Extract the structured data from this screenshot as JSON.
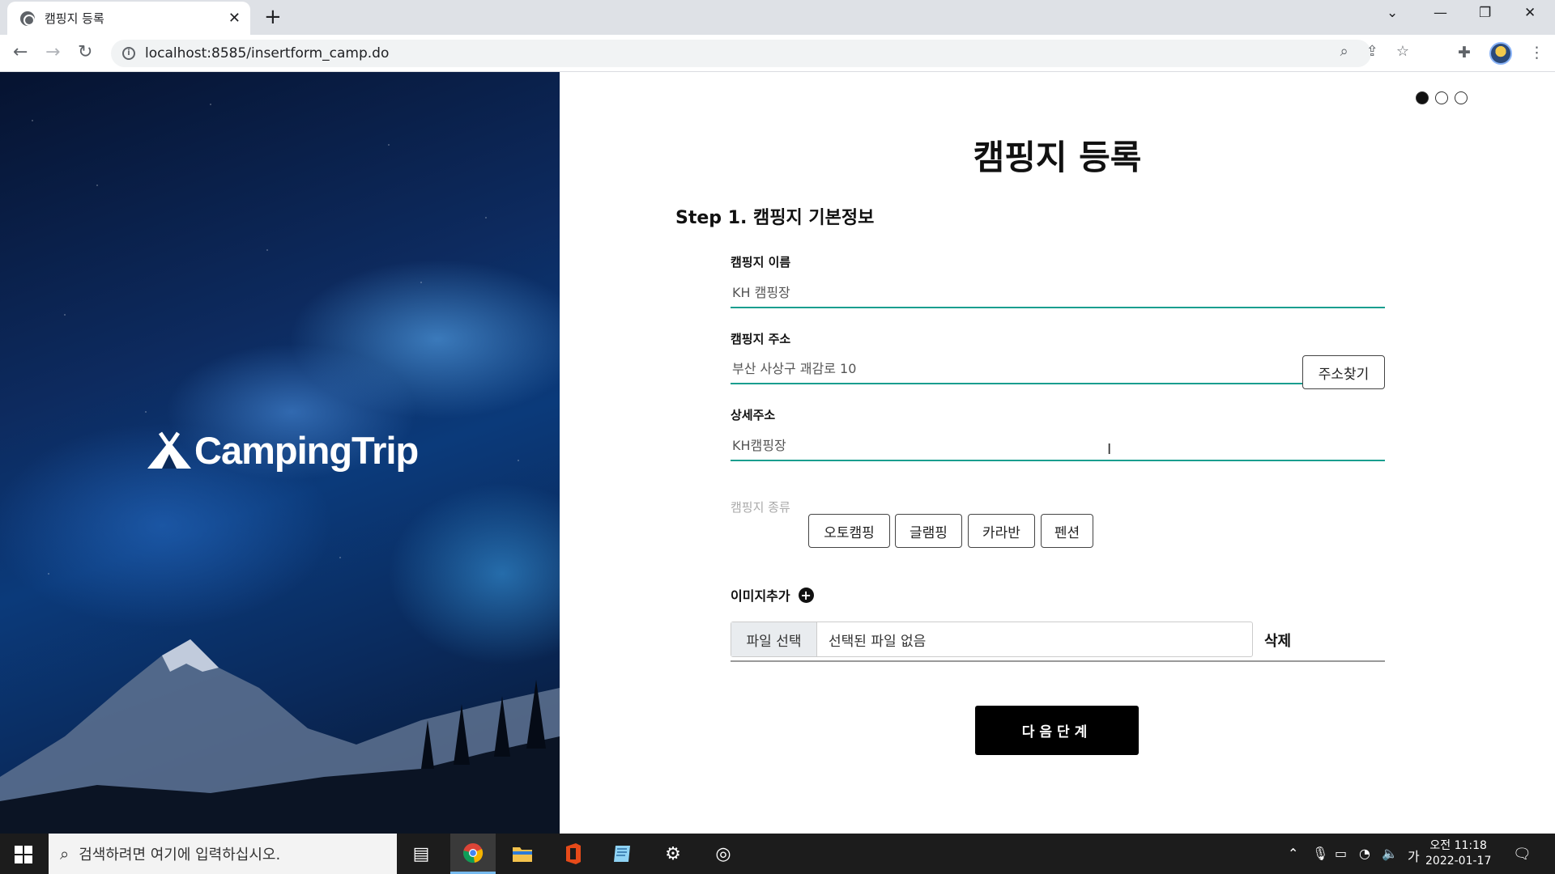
{
  "browser": {
    "tab_title": "캠핑지 등록",
    "new_tab": "+",
    "url": "localhost:8585/insertform_camp.do"
  },
  "hero": {
    "brand": "CampingTrip"
  },
  "form": {
    "page_title": "캠핑지 등록",
    "step_title": "Step 1. 캠핑지 기본정보",
    "progress": {
      "current_step": 1,
      "total_steps": 3
    },
    "name_label": "캠핑지 이름",
    "name_value": "KH 캠핑장",
    "address_label": "캠핑지 주소",
    "address_value": "부산 사상구 괘감로 10",
    "address_button": "주소찾기",
    "detail_label": "상세주소",
    "detail_value": "KH캠핑장",
    "type_label": "캠핑지 종류",
    "types": [
      "오토캠핑",
      "글램핑",
      "카라반",
      "펜션"
    ],
    "image_label": "이미지추가",
    "file_button": "파일 선택",
    "file_status": "선택된 파일 없음",
    "delete_button": "삭제",
    "next_button": "다음단계"
  },
  "taskbar": {
    "search_placeholder": "검색하려면 여기에 입력하십시오.",
    "ime": "가",
    "time": "오전 11:18",
    "date": "2022-01-17"
  },
  "colors": {
    "accent_underline": "#1a9e8f",
    "primary_button": "#000000"
  }
}
